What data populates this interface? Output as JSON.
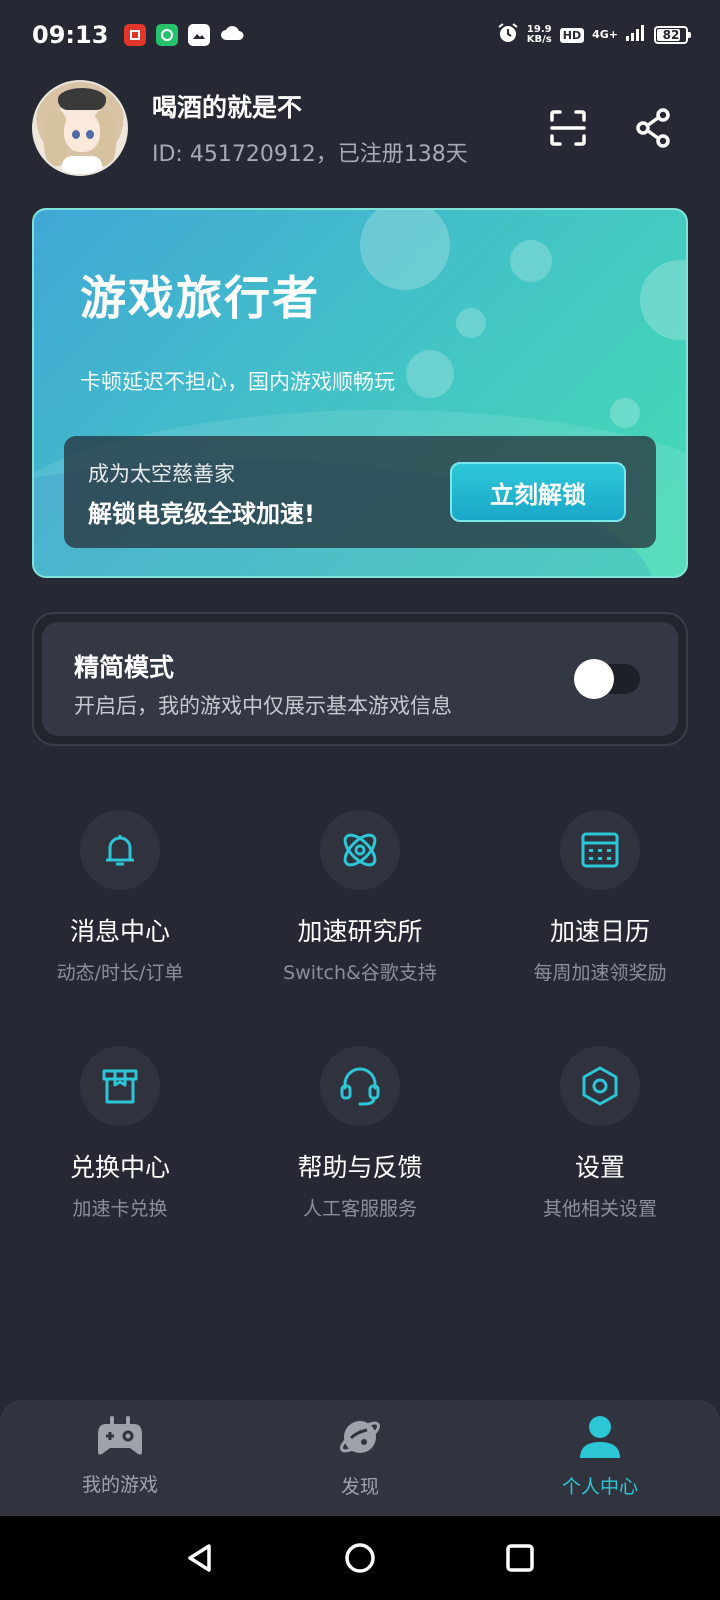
{
  "status_bar": {
    "time": "09:13",
    "speed_value": "19.9",
    "speed_unit": "KB/s",
    "hd": "HD",
    "network": "4G+",
    "battery": "82",
    "battery_level": 0.82,
    "icons": [
      "app-icon-red",
      "app-icon-green",
      "photos-icon",
      "cloud-icon",
      "alarm-icon",
      "signal-icon"
    ]
  },
  "profile": {
    "name": "喝酒的就是不",
    "id_text": "ID: 451720912，已注册138天",
    "tools": [
      "scan-icon",
      "share-icon"
    ]
  },
  "banner": {
    "title": "游戏旅行者",
    "subtitle": "卡顿延迟不担心，国内游戏顺畅玩",
    "promo_line1": "成为太空慈善家",
    "promo_line2": "解锁电竞级全球加速!",
    "unlock_label": "立刻解锁",
    "accent": "#2ec8d8"
  },
  "simple_mode": {
    "title": "精简模式",
    "desc": "开启后，我的游戏中仅展示基本游戏信息",
    "enabled": false
  },
  "menu": [
    {
      "icon": "bell-icon",
      "label": "消息中心",
      "sub": "动态/时长/订单"
    },
    {
      "icon": "atom-icon",
      "label": "加速研究所",
      "sub": "Switch&谷歌支持"
    },
    {
      "icon": "calendar-icon",
      "label": "加速日历",
      "sub": "每周加速领奖励"
    },
    {
      "icon": "gift-box-icon",
      "label": "兑换中心",
      "sub": "加速卡兑换"
    },
    {
      "icon": "headset-icon",
      "label": "帮助与反馈",
      "sub": "人工客服服务"
    },
    {
      "icon": "settings-hexagon-icon",
      "label": "设置",
      "sub": "其他相关设置"
    }
  ],
  "nav": {
    "items": [
      {
        "icon": "gamepad-icon",
        "label": "我的游戏",
        "active": false
      },
      {
        "icon": "planet-icon",
        "label": "发现",
        "active": false
      },
      {
        "icon": "person-icon",
        "label": "个人中心",
        "active": true
      }
    ],
    "active_color": "#2cc6d6"
  },
  "system_nav": [
    "back-icon",
    "home-icon",
    "recents-icon"
  ]
}
